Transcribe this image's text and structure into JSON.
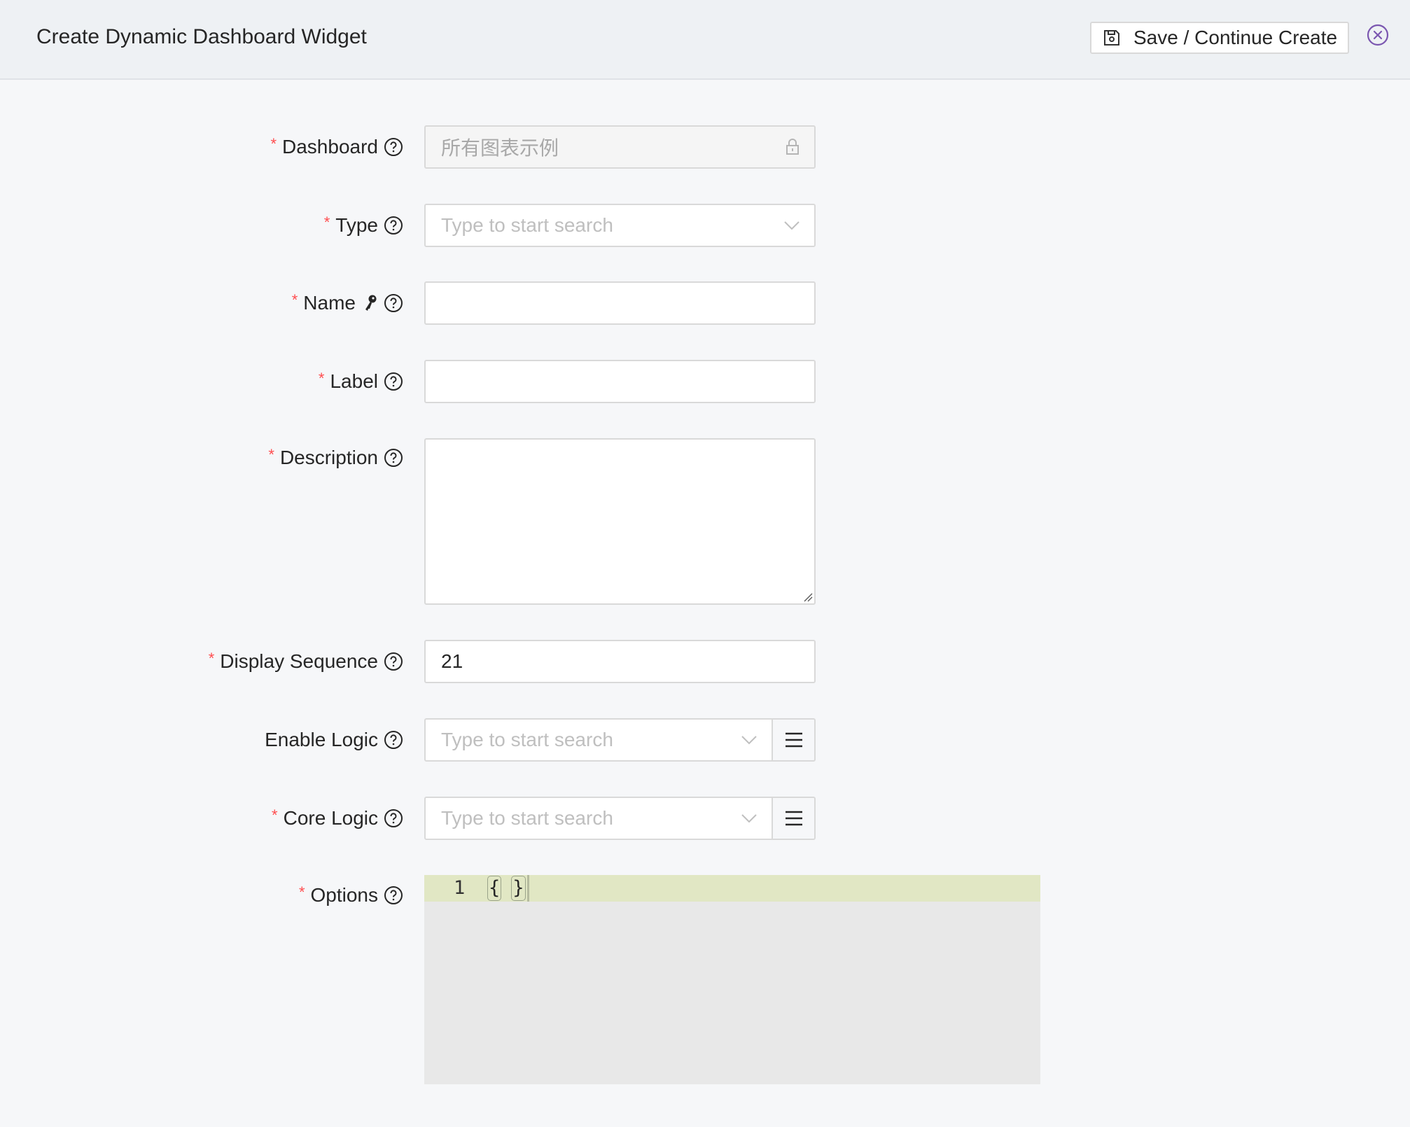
{
  "header": {
    "title": "Create Dynamic Dashboard Widget",
    "save_button_label": "Save / Continue Create",
    "save_icon": "save-icon",
    "close_icon": "close-circle-icon",
    "accent_color": "#7b57b0"
  },
  "form": {
    "required_mark": "*",
    "fields": {
      "dashboard": {
        "label": "Dashboard",
        "required": true,
        "value": "所有图表示例",
        "disabled": true,
        "suffix_icon": "lock-icon"
      },
      "type": {
        "label": "Type",
        "required": true,
        "placeholder": "Type to start search",
        "value": "",
        "suffix_icon": "chevron-down-icon"
      },
      "name": {
        "label": "Name",
        "required": true,
        "value": "",
        "extra_icon": "key-icon"
      },
      "label": {
        "label": "Label",
        "required": true,
        "value": ""
      },
      "description": {
        "label": "Description",
        "required": true,
        "value": ""
      },
      "display_sequence": {
        "label": "Display Sequence",
        "required": true,
        "value": "21"
      },
      "enable_logic": {
        "label": "Enable Logic",
        "required": false,
        "placeholder": "Type to start search",
        "value": "",
        "action_icon": "menu-icon"
      },
      "core_logic": {
        "label": "Core Logic",
        "required": true,
        "placeholder": "Type to start search",
        "value": "",
        "action_icon": "menu-icon"
      },
      "options": {
        "label": "Options",
        "required": true,
        "lines": [
          {
            "number": "1",
            "open": "{",
            "close": "}"
          }
        ]
      }
    }
  }
}
